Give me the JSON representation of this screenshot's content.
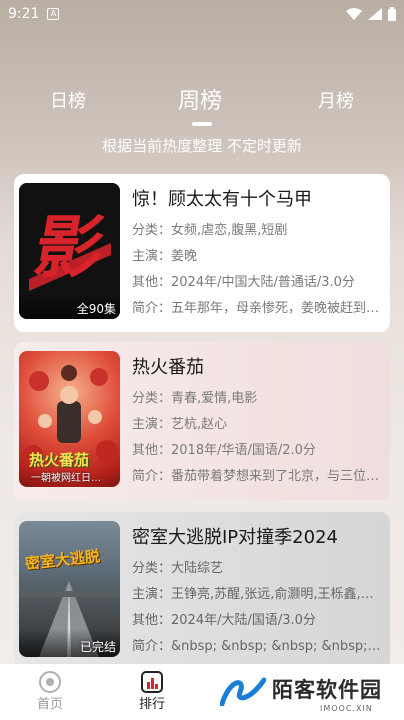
{
  "status": {
    "time": "9:21",
    "notif_glyph": "A"
  },
  "tabs": {
    "day": "日榜",
    "week": "周榜",
    "month": "月榜"
  },
  "subtitle": "根据当前热度整理 不定时更新",
  "cards": [
    {
      "title": "惊！顾太太有十个马甲",
      "genre": "分类：女频,虐恋,腹黑,短剧",
      "cast": "主演：姜晚",
      "other": "其他：2024年/中国大陆/普通话/3.0分",
      "intro": "简介：五年那年，母亲惨死，姜晚被赶到…",
      "badge": "全90集",
      "poster_glyph": "影"
    },
    {
      "title": "热火番茄",
      "genre": "分类：青春,爱情,电影",
      "cast": "主演：艺杭,赵心",
      "other": "其他：2018年/华语/国语/2.0分",
      "intro": "简介：番茄带着梦想来到了北京，与三位…",
      "poster_text": "热火番茄",
      "poster_tagline": "一朝被网红日…"
    },
    {
      "title": "密室大逃脱IP对撞季2024",
      "genre": "分类：大陆综艺",
      "cast": "主演：王铮亮,苏醒,张远,俞灏明,王栎鑫,…",
      "other": "其他：2024年/大陆/国语/3.0分",
      "intro": "简介：&nbsp; &nbsp; &nbsp; &nbsp; 《密…",
      "badge": "已完结",
      "poster_text": "密室大逃脱"
    }
  ],
  "bottom_nav": {
    "home": "首页",
    "rank": "排行"
  },
  "watermark": {
    "name": "陌客软件园",
    "sub": "IMOOC.XIN"
  },
  "colors": {
    "accent_red": "#d8232a",
    "poster1_bg": "#111111"
  }
}
